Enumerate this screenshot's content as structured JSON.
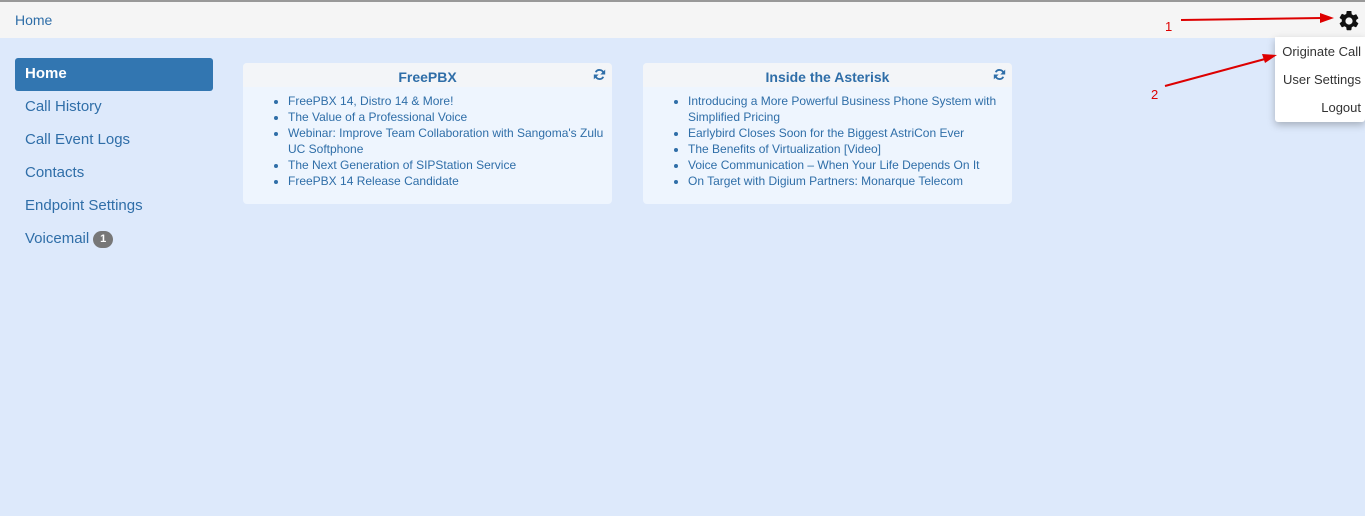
{
  "header": {
    "breadcrumb": "Home",
    "settings_icon": "gear-icon"
  },
  "sidebar": {
    "items": [
      {
        "label": "Home",
        "active": true
      },
      {
        "label": "Call History"
      },
      {
        "label": "Call Event Logs"
      },
      {
        "label": "Contacts"
      },
      {
        "label": "Endpoint Settings"
      },
      {
        "label": "Voicemail",
        "badge": "1"
      }
    ]
  },
  "panels": [
    {
      "title": "FreePBX",
      "items": [
        "FreePBX 14, Distro 14 & More!",
        "The Value of a Professional Voice",
        "Webinar: Improve Team Collaboration with Sangoma's Zulu UC Softphone",
        "The Next Generation of SIPStation Service",
        "FreePBX 14 Release Candidate"
      ]
    },
    {
      "title": "Inside the Asterisk",
      "items": [
        "Introducing a More Powerful Business Phone System with Simplified Pricing",
        "Earlybird Closes Soon for the Biggest AstriCon Ever",
        "The Benefits of Virtualization [Video]",
        "Voice Communication – When Your Life Depends On It",
        "On Target with Digium Partners: Monarque Telecom"
      ]
    }
  ],
  "dropdown": {
    "items": [
      "Originate Call",
      "User Settings",
      "Logout"
    ]
  },
  "annotations": {
    "label_1": "1",
    "label_2": "2",
    "color": "#dd0000"
  },
  "colors": {
    "link": "#2f6ea8",
    "active_nav": "#3276b1",
    "background": "#dde9fb"
  }
}
